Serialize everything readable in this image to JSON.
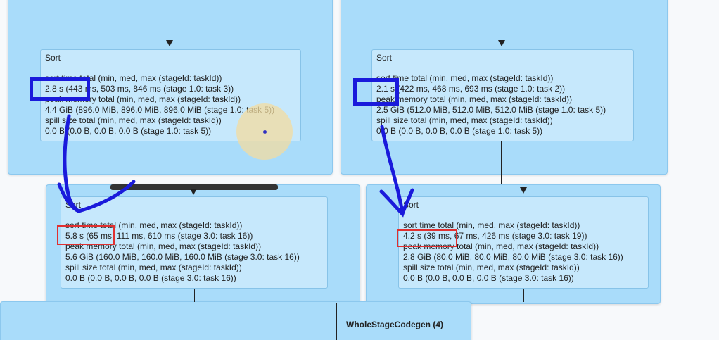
{
  "sort_nodes": [
    {
      "title": "Sort",
      "lines": [
        "sort time total (min, med, max (stageId: taskId))",
        "2.8 s (443 ms, 503 ms, 846 ms (stage 1.0: task 3))",
        "peak memory total (min, med, max (stageId: taskId))",
        "4.4 GiB (896.0 MiB, 896.0 MiB, 896.0 MiB (stage 1.0: task 5))",
        "spill size total (min, med, max (stageId: taskId))",
        "0.0 B (0.0 B, 0.0 B, 0.0 B (stage 1.0: task 5))"
      ]
    },
    {
      "title": "Sort",
      "lines": [
        "sort time total (min, med, max (stageId: taskId))",
        "2.1 s (422 ms, 468 ms, 693 ms (stage 1.0: task 2))",
        "peak memory total (min, med, max (stageId: taskId))",
        "2.5 GiB (512.0 MiB, 512.0 MiB, 512.0 MiB (stage 1.0: task 5))",
        "spill size total (min, med, max (stageId: taskId))",
        "0.0 B (0.0 B, 0.0 B, 0.0 B (stage 1.0: task 5))"
      ]
    },
    {
      "title": "Sort",
      "lines": [
        "sort time total (min, med, max (stageId: taskId))",
        "5.8 s (65 ms, 111 ms, 610 ms (stage 3.0: task 16))",
        "peak memory total (min, med, max (stageId: taskId))",
        "5.6 GiB (160.0 MiB, 160.0 MiB, 160.0 MiB (stage 3.0: task 16))",
        "spill size total (min, med, max (stageId: taskId))",
        "0.0 B (0.0 B, 0.0 B, 0.0 B (stage 3.0: task 16))"
      ]
    },
    {
      "title": "Sort",
      "lines": [
        "sort time total (min, med, max (stageId: taskId))",
        "4.2 s (39 ms, 67 ms, 426 ms (stage 3.0: task 19))",
        "peak memory total (min, med, max (stageId: taskId))",
        "2.8 GiB (80.0 MiB, 80.0 MiB, 80.0 MiB (stage 3.0: task 16))",
        "spill size total (min, med, max (stageId: taskId))",
        "0.0 B (0.0 B, 0.0 B, 0.0 B (stage 3.0: task 16))"
      ]
    }
  ],
  "whole_stage_codegen": {
    "title": "WholeStageCodegen (4)"
  },
  "colors": {
    "stage_bg": "#a9dcfa",
    "node_bg": "#c6e8fc",
    "annotation_blue": "#1a1adb",
    "annotation_red": "#e03030",
    "cursor_highlight": "#f3dca0"
  }
}
